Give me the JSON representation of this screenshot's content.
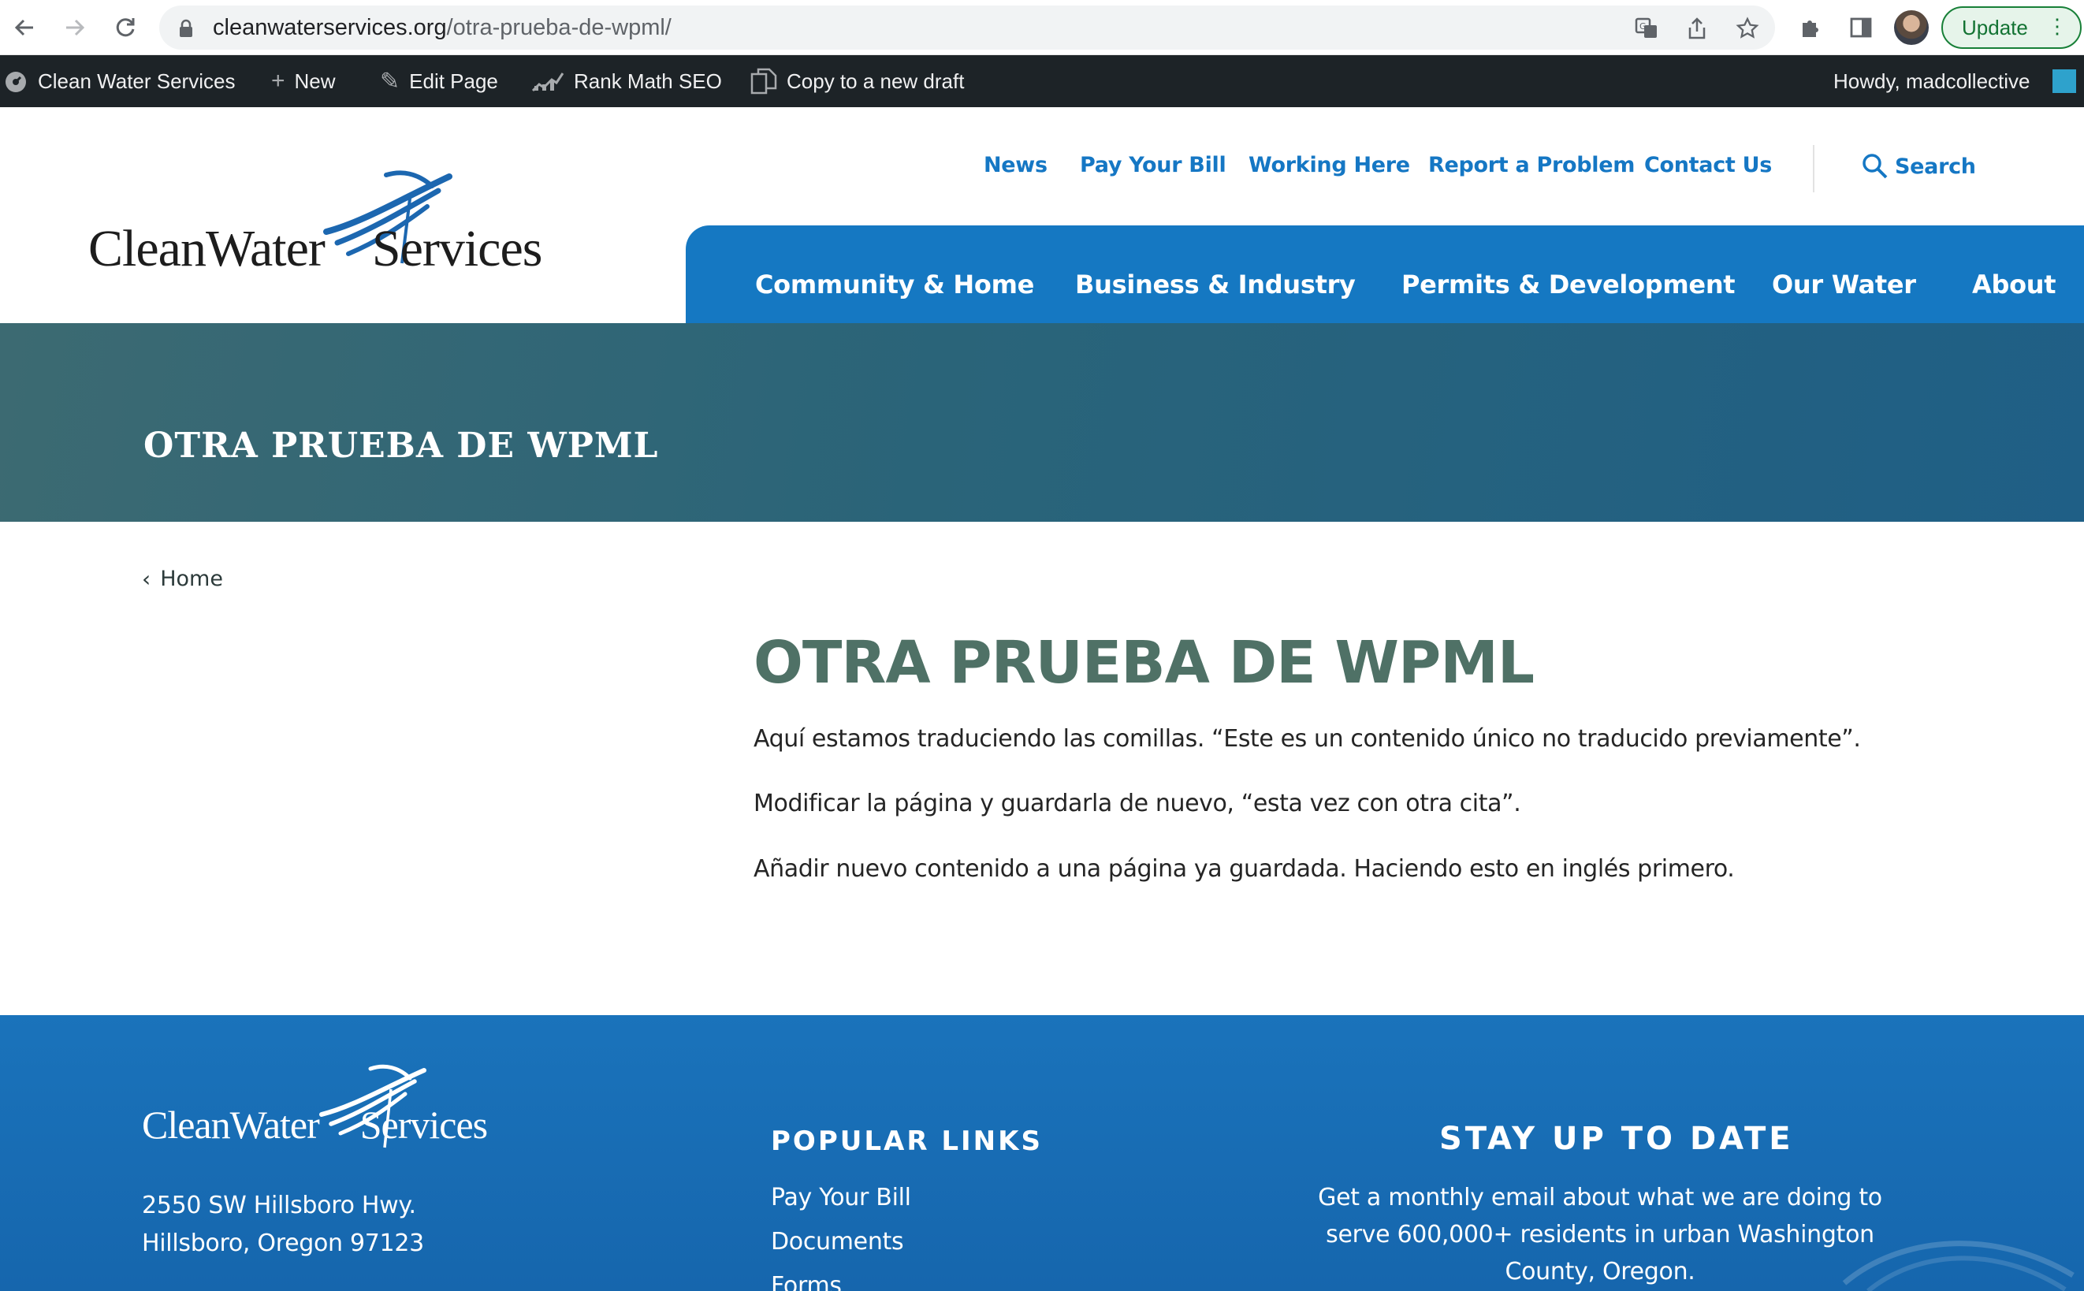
{
  "browser": {
    "url_host": "cleanwaterservices.org",
    "url_path": "/otra-prueba-de-wpml/",
    "update_label": "Update"
  },
  "adminbar": {
    "site_name": "Clean Water Services",
    "new_label": "New",
    "edit_label": "Edit Page",
    "seo_label": "Rank Math SEO",
    "copy_label": "Copy to a new draft",
    "howdy": "Howdy, madcollective"
  },
  "header": {
    "logo_part1": "CleanWater",
    "logo_part2": "Services",
    "utility": [
      "News",
      "Pay Your Bill",
      "Working Here",
      "Report a Problem",
      "Contact Us"
    ],
    "search_label": "Search",
    "main_nav": [
      "Community & Home",
      "Business & Industry",
      "Permits & Development",
      "Our Water",
      "About"
    ],
    "brand_color": "#1578c2"
  },
  "hero": {
    "title": "OTRA PRUEBA DE WPML"
  },
  "content": {
    "breadcrumb": "Home",
    "title": "OTRA PRUEBA DE WPML",
    "paragraphs": [
      "Aquí estamos traduciendo las comillas. “Este es un contenido único no traducido previamente”.",
      "Modificar la página y guardarla de nuevo, “esta vez con otra cita”.",
      "Añadir nuevo contenido a una página ya guardada. Haciendo esto en inglés primero."
    ]
  },
  "footer": {
    "logo_part1": "CleanWater",
    "logo_part2": "Services",
    "address_line1": "2550 SW Hillsboro Hwy.",
    "address_line2": "Hillsboro, Oregon 97123",
    "popular_heading": "POPULAR LINKS",
    "popular_links": [
      "Pay Your Bill",
      "Documents",
      "Forms"
    ],
    "stay_heading": "STAY UP TO DATE",
    "stay_text": "Get a monthly email about what we are doing to serve 600,000+ residents in urban Washington County, Oregon."
  }
}
